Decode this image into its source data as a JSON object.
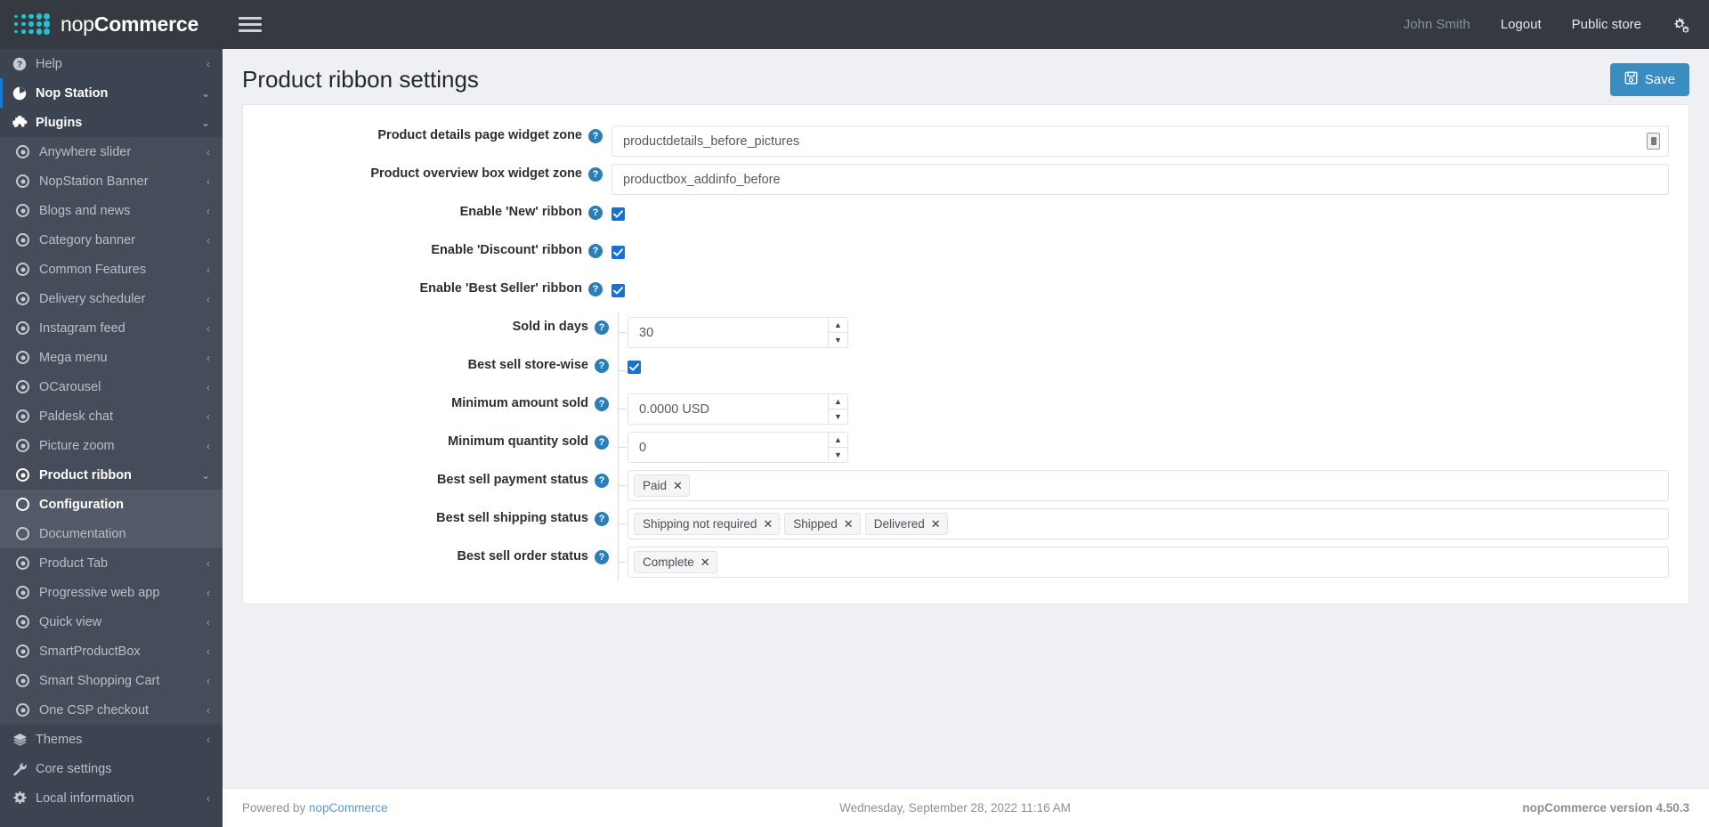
{
  "brand": {
    "name_light": "nop",
    "name_bold": "Commerce"
  },
  "topbar": {
    "user": "John Smith",
    "logout": "Logout",
    "public_store": "Public store"
  },
  "sidebar": {
    "items": [
      {
        "label": "Help",
        "icon": "question-circle-icon",
        "level": 0,
        "caret": "‹",
        "state": "normal"
      },
      {
        "label": "Nop Station",
        "icon": "pie-chart-icon",
        "level": 0,
        "caret": "⌄",
        "state": "active-blue"
      },
      {
        "label": "Plugins",
        "icon": "puzzle-icon",
        "level": 1,
        "caret": "⌄",
        "state": "open-parent"
      },
      {
        "label": "Anywhere slider",
        "icon": "radio-icon",
        "level": 1,
        "caret": "‹",
        "state": "sub"
      },
      {
        "label": "NopStation Banner",
        "icon": "radio-icon",
        "level": 1,
        "caret": "‹",
        "state": "sub"
      },
      {
        "label": "Blogs and news",
        "icon": "radio-icon",
        "level": 1,
        "caret": "‹",
        "state": "sub"
      },
      {
        "label": "Category banner",
        "icon": "radio-icon",
        "level": 1,
        "caret": "‹",
        "state": "sub"
      },
      {
        "label": "Common Features",
        "icon": "radio-icon",
        "level": 1,
        "caret": "‹",
        "state": "sub"
      },
      {
        "label": "Delivery scheduler",
        "icon": "radio-icon",
        "level": 1,
        "caret": "‹",
        "state": "sub"
      },
      {
        "label": "Instagram feed",
        "icon": "radio-icon",
        "level": 1,
        "caret": "‹",
        "state": "sub"
      },
      {
        "label": "Mega menu",
        "icon": "radio-icon",
        "level": 1,
        "caret": "‹",
        "state": "sub"
      },
      {
        "label": "OCarousel",
        "icon": "radio-icon",
        "level": 1,
        "caret": "‹",
        "state": "sub"
      },
      {
        "label": "Paldesk chat",
        "icon": "radio-icon",
        "level": 1,
        "caret": "‹",
        "state": "sub"
      },
      {
        "label": "Picture zoom",
        "icon": "radio-icon",
        "level": 1,
        "caret": "‹",
        "state": "sub"
      },
      {
        "label": "Product ribbon",
        "icon": "radio-icon",
        "level": 1,
        "caret": "⌄",
        "state": "sub-cur"
      },
      {
        "label": "Configuration",
        "icon": "circle-icon",
        "level": 2,
        "caret": "",
        "state": "sub2-cur"
      },
      {
        "label": "Documentation",
        "icon": "circle-icon",
        "level": 2,
        "caret": "",
        "state": "sub2"
      },
      {
        "label": "Product Tab",
        "icon": "radio-icon",
        "level": 1,
        "caret": "‹",
        "state": "sub"
      },
      {
        "label": "Progressive web app",
        "icon": "radio-icon",
        "level": 1,
        "caret": "‹",
        "state": "sub"
      },
      {
        "label": "Quick view",
        "icon": "radio-icon",
        "level": 1,
        "caret": "‹",
        "state": "sub"
      },
      {
        "label": "SmartProductBox",
        "icon": "radio-icon",
        "level": 1,
        "caret": "‹",
        "state": "sub"
      },
      {
        "label": "Smart Shopping Cart",
        "icon": "radio-icon",
        "level": 1,
        "caret": "‹",
        "state": "sub"
      },
      {
        "label": "One CSP checkout",
        "icon": "radio-icon",
        "level": 1,
        "caret": "‹",
        "state": "sub"
      },
      {
        "label": "Themes",
        "icon": "layers-icon",
        "level": 0,
        "caret": "‹",
        "state": "normal"
      },
      {
        "label": "Core settings",
        "icon": "wrench-icon",
        "level": 0,
        "caret": "",
        "state": "normal"
      },
      {
        "label": "Local information",
        "icon": "gear-icon",
        "level": 0,
        "caret": "‹",
        "state": "normal"
      }
    ]
  },
  "page": {
    "title": "Product ribbon settings",
    "save_label": "Save"
  },
  "form": {
    "fields": [
      {
        "label": "Product details page widget zone",
        "type": "text",
        "value": "productdetails_before_pictures",
        "nested": false,
        "resize": true
      },
      {
        "label": "Product overview box widget zone",
        "type": "text",
        "value": "productbox_addinfo_before",
        "nested": false,
        "resize": false
      },
      {
        "label": "Enable 'New' ribbon",
        "type": "check",
        "value": "checked",
        "nested": false
      },
      {
        "label": "Enable 'Discount' ribbon",
        "type": "check",
        "value": "checked",
        "nested": false
      },
      {
        "label": "Enable 'Best Seller' ribbon",
        "type": "check",
        "value": "checked",
        "nested": false
      }
    ],
    "nested_fields": [
      {
        "label": "Sold in days",
        "type": "spin",
        "value": "30"
      },
      {
        "label": "Best sell store-wise",
        "type": "check",
        "value": "checked"
      },
      {
        "label": "Minimum amount sold",
        "type": "spin",
        "value": "0.0000 USD"
      },
      {
        "label": "Minimum quantity sold",
        "type": "spin",
        "value": "0"
      },
      {
        "label": "Best sell payment status",
        "type": "tags",
        "tags": [
          "Paid"
        ]
      },
      {
        "label": "Best sell shipping status",
        "type": "tags",
        "tags": [
          "Shipping not required",
          "Shipped",
          "Delivered"
        ]
      },
      {
        "label": "Best sell order status",
        "type": "tags",
        "tags": [
          "Complete"
        ]
      }
    ],
    "tag_remove_glyph": "✕",
    "spin_up": "▲",
    "spin_down": "▼"
  },
  "footer": {
    "powered_by": "Powered by ",
    "powered_link": "nopCommerce",
    "datetime": "Wednesday, September 28, 2022 11:16 AM",
    "version": "nopCommerce version 4.50.3"
  },
  "colors": {
    "accent": "#1272d6",
    "save_button": "#3a8dc0",
    "brand_dot": "#26bfd4",
    "sidebar": "#3d4451",
    "topbar": "#343a40"
  }
}
